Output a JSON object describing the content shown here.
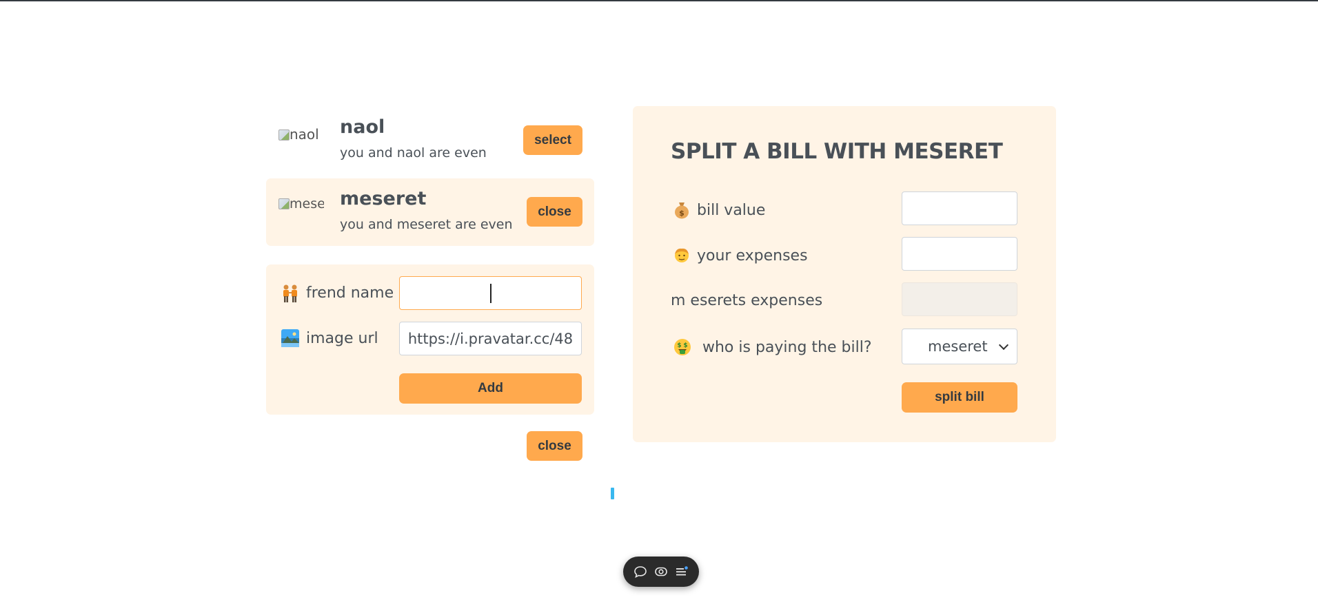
{
  "friends": [
    {
      "name": "naol",
      "status": "you and naol are even",
      "avatar_alt": "naol",
      "button_label": "select",
      "selected": false
    },
    {
      "name": "meseret",
      "status": "you and meseret are even",
      "avatar_alt": "meseret",
      "button_label": "close",
      "selected": true
    }
  ],
  "add_friend_form": {
    "name_label": "frend name",
    "name_value": "",
    "image_label": "image url",
    "image_value": "https://i.pravatar.cc/48",
    "add_label": "Add",
    "name_icon": "people-holding-hands-icon",
    "image_icon": "picture-icon"
  },
  "close_form_label": "close",
  "split_bill": {
    "title": "SPLIT A BILL WITH MESERET",
    "bill_label": "bill value",
    "bill_icon": "money-bag-icon",
    "bill_value": "",
    "your_label": "your expenses",
    "your_icon": "person-icon",
    "your_value": "",
    "friend_label": "m eserets expenses",
    "friend_value": "",
    "payer_label": "who is paying the bill?",
    "payer_icon": "money-mouth-face-icon",
    "payer_selected": "meseret",
    "submit_label": "split bill"
  },
  "colors": {
    "accent": "#ffa94d",
    "panel_bg": "#fff4e6",
    "text": "#495057"
  },
  "toolbar_icons": [
    "chat-bubble-icon",
    "eye-icon",
    "menu-list-icon"
  ]
}
